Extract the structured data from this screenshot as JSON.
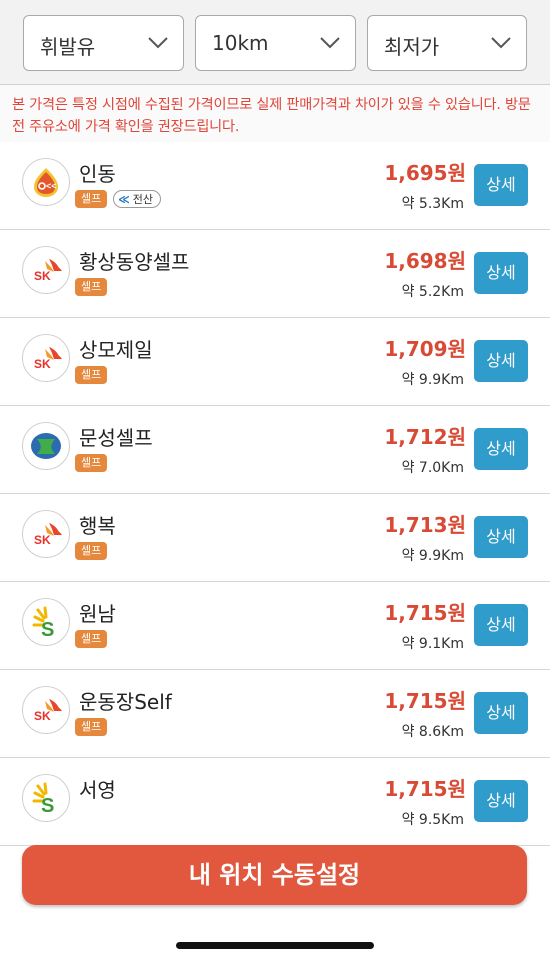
{
  "filters": {
    "fuel": "휘발유",
    "radius": "10km",
    "sort": "최저가"
  },
  "notice": "본 가격은 특정 시점에 수집된 가격이므로 실제 판매가격과 차이가 있을 수 있습니다. 방문 전 주유소에 가격 확인을 권장드립니다.",
  "stations": [
    {
      "name": "인동",
      "badge": "셀프",
      "payment": "전산",
      "price": "1,695원",
      "distance": "약 5.3Km",
      "brand": "s-oil-icon",
      "detail": "상세"
    },
    {
      "name": "황상동양셀프",
      "badge": "셀프",
      "price": "1,698원",
      "distance": "약 5.2Km",
      "brand": "sk-icon",
      "detail": "상세"
    },
    {
      "name": "상모제일",
      "badge": "셀프",
      "price": "1,709원",
      "distance": "약 9.9Km",
      "brand": "sk-icon",
      "detail": "상세"
    },
    {
      "name": "문성셀프",
      "badge": "셀프",
      "price": "1,712원",
      "distance": "약 7.0Km",
      "brand": "hyundai-oilbank-icon",
      "detail": "상세"
    },
    {
      "name": "행복",
      "badge": "셀프",
      "price": "1,713원",
      "distance": "약 9.9Km",
      "brand": "sk-icon",
      "detail": "상세"
    },
    {
      "name": "원남",
      "badge": "셀프",
      "price": "1,715원",
      "distance": "약 9.1Km",
      "brand": "gs-caltex-icon",
      "detail": "상세"
    },
    {
      "name": "운동장Self",
      "badge": "셀프",
      "price": "1,715원",
      "distance": "약 8.6Km",
      "brand": "sk-icon",
      "detail": "상세"
    },
    {
      "name": "서영",
      "price": "1,715원",
      "distance": "약 9.5Km",
      "brand": "gs-caltex-icon",
      "detail": "상세"
    }
  ],
  "bottom_button": "내 위치 수동설정",
  "colors": {
    "price": "#d84a35",
    "detail_button": "#2f9ccc",
    "self_badge": "#e5883b",
    "bottom_button": "#e1583f",
    "notice_text": "#e0463a"
  }
}
